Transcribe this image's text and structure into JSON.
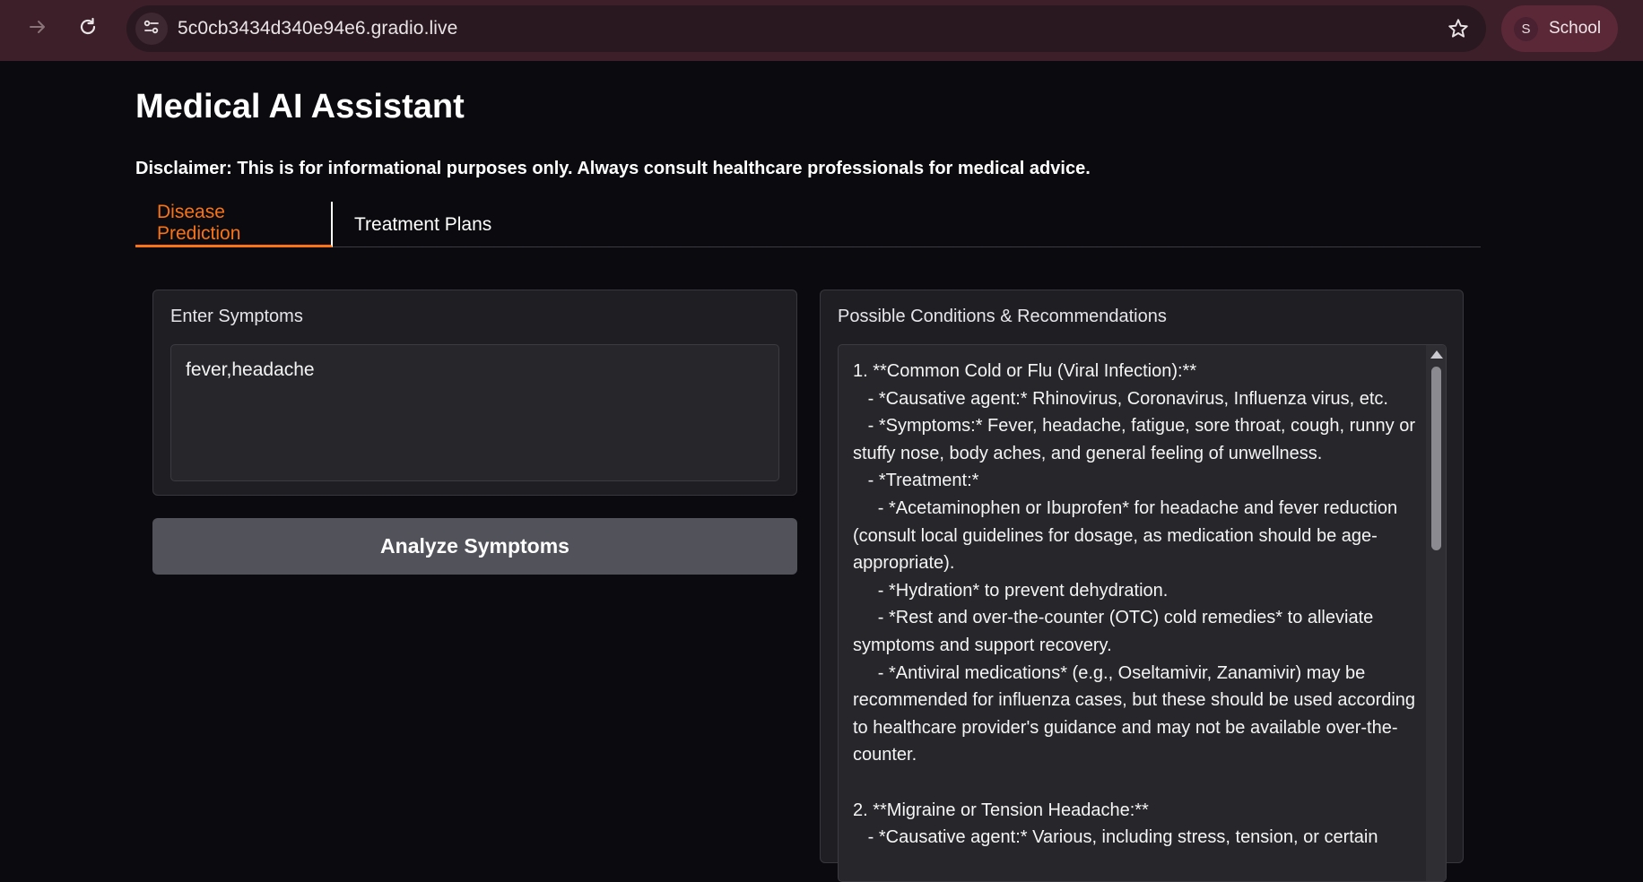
{
  "browser": {
    "url": "5c0cb3434d340e94e6.gradio.live",
    "profile_initial": "S",
    "profile_name": "School",
    "icons": [
      "forward-arrow-icon",
      "reload-icon",
      "site-info-icon",
      "star-icon"
    ]
  },
  "app": {
    "title": "Medical AI Assistant",
    "disclaimer": "Disclaimer: This is for informational purposes only. Always consult healthcare professionals for medical advice."
  },
  "tabs": [
    {
      "label": "Disease Prediction",
      "active": true
    },
    {
      "label": "Treatment Plans",
      "active": false
    }
  ],
  "input_panel": {
    "label": "Enter Symptoms",
    "value": "fever,headache"
  },
  "analyze_button": {
    "label": "Analyze Symptoms"
  },
  "output_panel": {
    "label": "Possible Conditions & Recommendations",
    "text": "1. **Common Cold or Flu (Viral Infection):**\n   - *Causative agent:* Rhinovirus, Coronavirus, Influenza virus, etc.\n   - *Symptoms:* Fever, headache, fatigue, sore throat, cough, runny or stuffy nose, body aches, and general feeling of unwellness.\n   - *Treatment:*\n     - *Acetaminophen or Ibuprofen* for headache and fever reduction (consult local guidelines for dosage, as medication should be age-appropriate).\n     - *Hydration* to prevent dehydration.\n     - *Rest and over-the-counter (OTC) cold remedies* to alleviate symptoms and support recovery.\n     - *Antiviral medications* (e.g., Oseltamivir, Zanamivir) may be recommended for influenza cases, but these should be used according to healthcare provider's guidance and may not be available over-the-counter.\n\n2. **Migraine or Tension Headache:**\n   - *Causative agent:* Various, including stress, tension, or certain"
  },
  "colors": {
    "accent": "#f97316",
    "browser_bar": "#3c1f29",
    "background": "#0b0b0f",
    "panel": "#1f1f23",
    "button": "#52525b"
  }
}
